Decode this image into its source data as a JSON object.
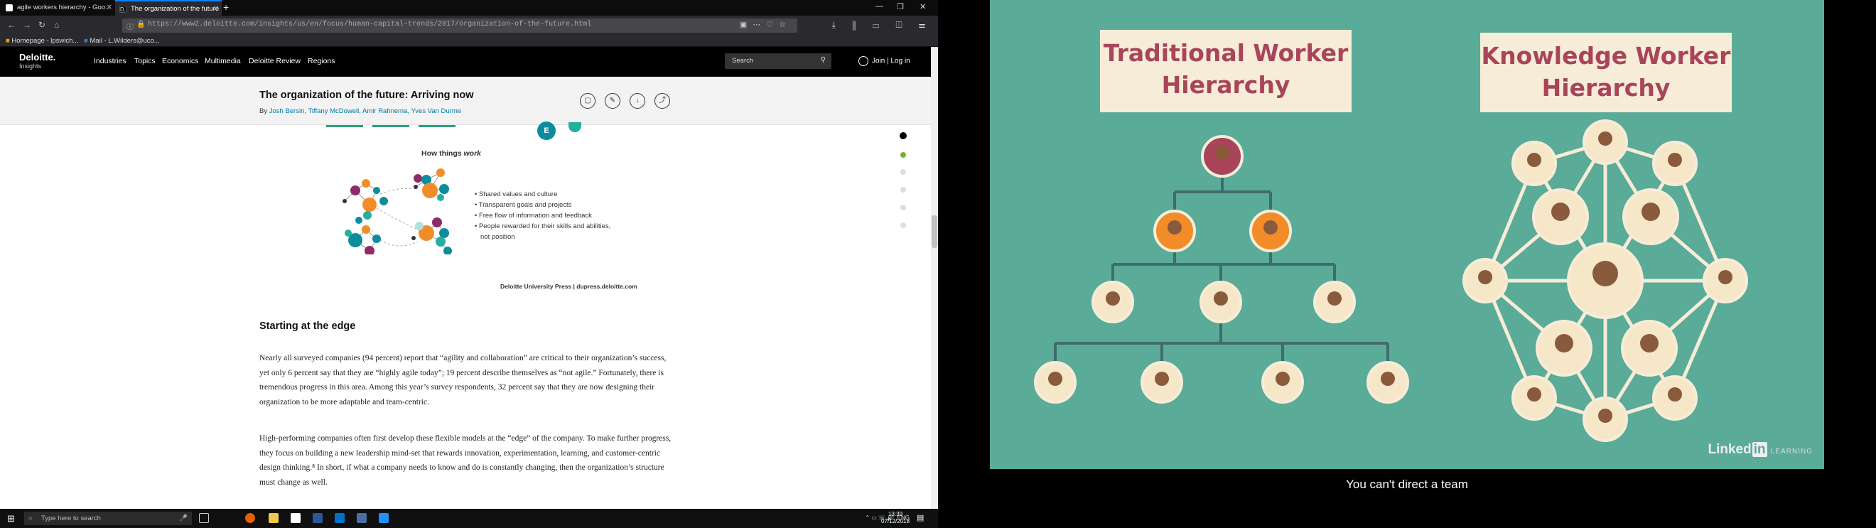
{
  "browser": {
    "tabs": [
      {
        "label": "agile workers hierarchy - Goo...",
        "active": false
      },
      {
        "label": "The organization of the future",
        "active": true
      }
    ],
    "url": "https://www2.deloitte.com/insights/us/en/focus/human-capital-trends/2017/organization-of-the-future.html",
    "url_domain": "deloitte.com",
    "bookmarks": [
      "Homepage - lpswich...",
      "Mail - L.Wilders@uco..."
    ]
  },
  "site": {
    "logo": "Deloitte.",
    "logo_sub": "Insights",
    "nav": [
      "Industries",
      "Topics",
      "Economics",
      "Multimedia",
      "Deloitte Review",
      "Regions"
    ],
    "search_placeholder": "Search",
    "join": "Join | Log in"
  },
  "article": {
    "title": "The organization of the future: Arriving now",
    "by": "By",
    "authors": "Josh Bersin, Tiffany McDowell, Amir Rahnema, Yves Van Durme",
    "figure": {
      "heading_prefix": "How things",
      "heading_em": "work",
      "node_label": "E",
      "bullets": [
        "Shared values and culture",
        "Transparent goals and projects",
        "Free flow of information and  feedback",
        "People rewarded for their skills and abilities,",
        "not position"
      ],
      "credit": "Deloitte University Press  |  dupress.deloitte.com"
    },
    "section_heading": "Starting at the edge",
    "paragraphs": [
      "Nearly all surveyed companies (94 percent) report that “agility and collaboration” are critical to their organization’s success, yet only 6 percent say that they are “highly agile today”; 19 percent describe themselves as “not agile.” Fortunately, there is tremendous progress in this area. Among this year’s survey respondents, 32 percent say that they are now designing their organization to be more adaptable and team-centric.",
      "High-performing companies often first develop these flexible models at the “edge” of the company. To make further progress, they focus on building a new leadership mind-set that rewards innovation, experimentation, learning, and customer-centric design thinking.⁸ In short, if what a company needs to know and do is constantly changing, then the organization’s structure must change as well."
    ]
  },
  "taskbar": {
    "search_placeholder": "Type here to search",
    "time": "13:39",
    "date": "07/12/2018",
    "lang": "ENG"
  },
  "video": {
    "box_left": [
      "Traditional Worker",
      "Hierarchy"
    ],
    "box_right": [
      "Knowledge Worker",
      "Hierarchy"
    ],
    "watermark": "Linked",
    "watermark_in": "in",
    "watermark_sub": "LEARNING",
    "caption": "You can't direct a team"
  },
  "colors": {
    "accent": "#0076a8",
    "video_bg": "#5aab98",
    "box_text": "#a8455a"
  }
}
